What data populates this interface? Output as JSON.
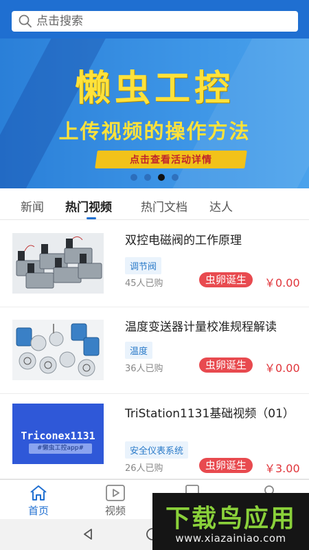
{
  "search": {
    "placeholder": "点击搜索"
  },
  "banner": {
    "title": "懒虫工控",
    "subtitle": "上传视频的操作方法",
    "cta": "点击查看活动详情",
    "dots_total": 4,
    "active_dot": 3
  },
  "tabs": [
    {
      "label": "新闻"
    },
    {
      "label": "热门视频"
    },
    {
      "label": "热门文档"
    },
    {
      "label": "达人"
    }
  ],
  "active_tab": "热门视频",
  "items": [
    {
      "title": "双控电磁阀的工作原理",
      "tag": "调节阀",
      "sold": "45人已购",
      "badge": "虫卵诞生",
      "price": "￥0.00",
      "thumb": "solenoid-valves-photo"
    },
    {
      "title": "温度变送器计量校准规程解读",
      "tag": "温度",
      "sold": "36人已购",
      "badge": "虫卵诞生",
      "price": "￥0.00",
      "thumb": "temperature-transmitters-photo"
    },
    {
      "title": "TriStation1131基础视频（01）",
      "tag": "安全仪表系统",
      "sold": "26人已购",
      "badge": "虫卵诞生",
      "price": "￥3.00",
      "thumb": "triconex-cover",
      "thumb_text": "Triconex1131",
      "thumb_subtext": "#懒虫工控app#"
    }
  ],
  "bottom_nav": [
    {
      "label": "首页",
      "icon": "home-icon",
      "active": true
    },
    {
      "label": "视频",
      "icon": "video-icon",
      "active": false
    },
    {
      "label": "",
      "icon": "document-icon",
      "active": false
    },
    {
      "label": "",
      "icon": "profile-icon",
      "active": false
    }
  ],
  "watermark": {
    "title": "下载鸟应用",
    "url": "www.xiazainiao.com"
  },
  "colors": {
    "brand_blue": "#1f6fd1",
    "price_red": "#e0343a",
    "badge_red": "#e84a4f",
    "banner_yellow": "#ffe23a"
  }
}
